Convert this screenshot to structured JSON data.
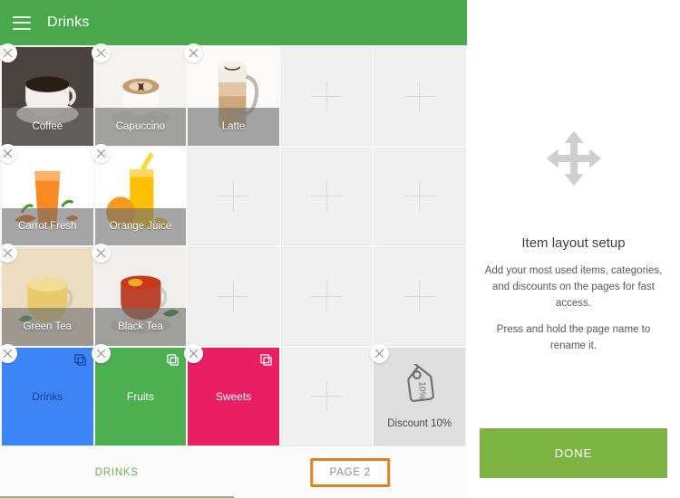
{
  "header": {
    "title": "Drinks",
    "menu_icon": "hamburger-menu-icon",
    "background_color": "#49a84c"
  },
  "grid": {
    "columns": 5,
    "rows": 4,
    "close_icon": "close-x-icon",
    "add_icon": "plus-icon",
    "cells": [
      {
        "type": "item",
        "label": "Coffee",
        "removable": true,
        "art": "coffee-cup-photo",
        "bg": "#4a4340"
      },
      {
        "type": "item",
        "label": "Capuccino",
        "removable": true,
        "art": "cappuccino-cup-photo",
        "bg": "#f2f2f2"
      },
      {
        "type": "item",
        "label": "Latte",
        "removable": true,
        "art": "latte-glass-photo",
        "bg": "#fbfbfb"
      },
      {
        "type": "empty",
        "label": "",
        "removable": false
      },
      {
        "type": "empty",
        "label": "",
        "removable": false
      },
      {
        "type": "item",
        "label": "Carrot Fresh",
        "removable": true,
        "art": "carrot-juice-photo",
        "bg": "#ffffff"
      },
      {
        "type": "item",
        "label": "Orange Juice",
        "removable": true,
        "art": "orange-juice-photo",
        "bg": "#ffffff"
      },
      {
        "type": "empty",
        "label": "",
        "removable": false
      },
      {
        "type": "empty",
        "label": "",
        "removable": false
      },
      {
        "type": "empty",
        "label": "",
        "removable": false
      },
      {
        "type": "item",
        "label": "Green Tea",
        "removable": true,
        "art": "green-tea-cup-photo",
        "bg": "#e9ddc9"
      },
      {
        "type": "item",
        "label": "Black Tea",
        "removable": true,
        "art": "black-tea-cup-photo",
        "bg": "#efefef"
      },
      {
        "type": "empty",
        "label": "",
        "removable": false
      },
      {
        "type": "empty",
        "label": "",
        "removable": false
      },
      {
        "type": "empty",
        "label": "",
        "removable": false
      },
      {
        "type": "category",
        "label": "Drinks",
        "removable": true,
        "color": "#3d85f7",
        "text_color": "#1f3f8f",
        "icon": "copy-layers-icon"
      },
      {
        "type": "category",
        "label": "Fruits",
        "removable": true,
        "color": "#4caf50",
        "text_color": "#ffffff",
        "icon": "copy-layers-icon"
      },
      {
        "type": "category",
        "label": "Sweets",
        "removable": true,
        "color": "#e91e63",
        "text_color": "#ffffff",
        "icon": "copy-layers-icon"
      },
      {
        "type": "empty",
        "label": "",
        "removable": false
      },
      {
        "type": "discount",
        "label": "Discount 10%",
        "removable": true,
        "badge": "10%",
        "icon": "price-tag-icon"
      }
    ]
  },
  "tabs": {
    "items": [
      {
        "label": "DRINKS",
        "active": true
      },
      {
        "label": "PAGE 2",
        "active": false,
        "highlighted": true
      }
    ],
    "active_color": "#6fae54",
    "highlight_color": "#e2801f"
  },
  "panel": {
    "move_icon": "move-arrows-icon",
    "title": "Item layout setup",
    "body_1": "Add your most used items, categories, and discounts on the pages for fast access.",
    "body_2": "Press and hold the page name to rename it.",
    "done_label": "DONE",
    "done_color": "#7cb342"
  }
}
